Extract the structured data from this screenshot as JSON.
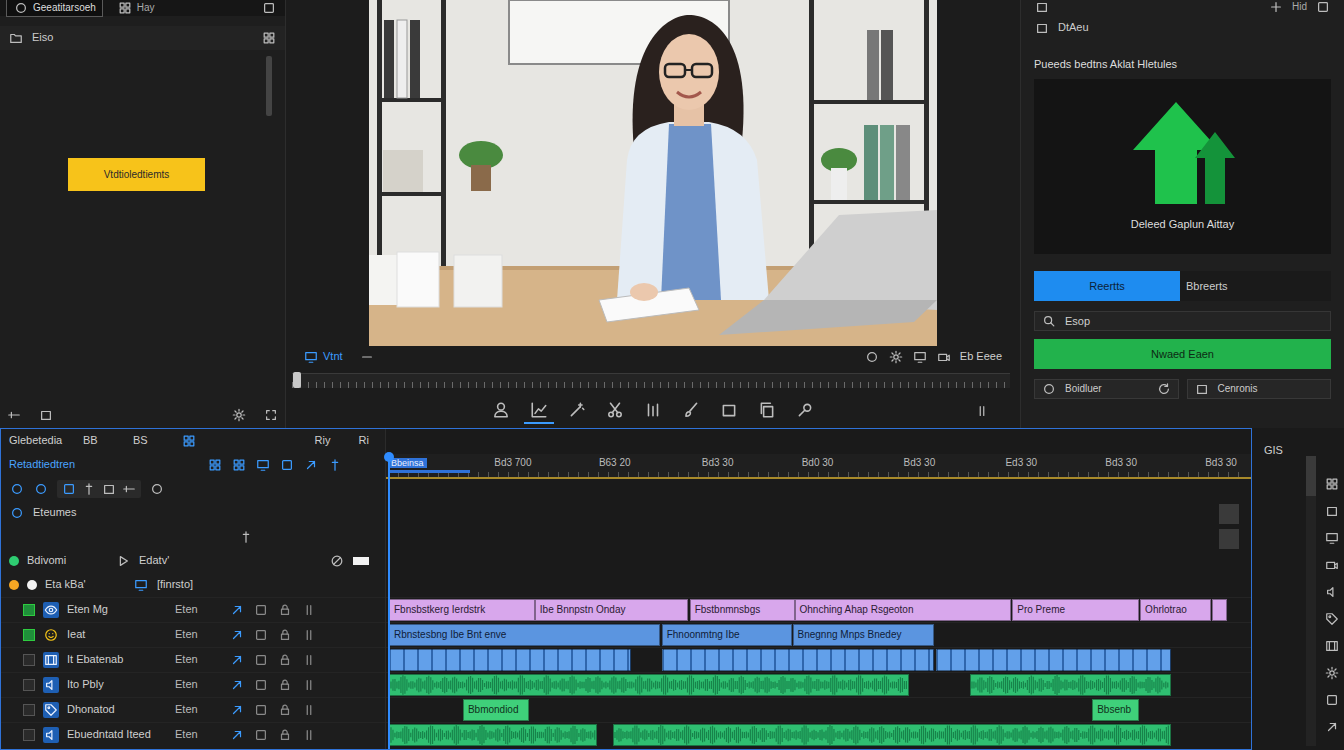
{
  "source_panel": {
    "tabs": [
      {
        "label": "Geeatitarsoeh",
        "selected": true
      },
      {
        "label": "Hay",
        "selected": false
      }
    ],
    "title": "Eiso",
    "button": "Vtdtioledtiemts"
  },
  "viewer": {
    "label_left": "Vtnt",
    "label_right": "Eb Eeee",
    "scrubber": {
      "level": 0
    }
  },
  "toolbar": [
    {
      "selected": false
    },
    {
      "selected": true
    },
    {
      "selected": false
    },
    {
      "selected": false
    },
    {
      "selected": false
    },
    {
      "selected": false
    },
    {
      "selected": false
    },
    {
      "selected": false
    },
    {
      "selected": false
    }
  ],
  "inspector": {
    "top_label": "Hid",
    "title": "DtAeu",
    "heading": "Pueeds bedtns Aklat Hletules",
    "preview_caption": "Deleed Gaplun Aittay",
    "tabs": [
      {
        "label": "Reertts",
        "selected": true
      },
      {
        "label": "Bbreerts",
        "selected": false
      }
    ],
    "field": {
      "value": "Esop"
    },
    "primary_button": "Nwaed Eaen",
    "buttons": [
      "Boidluer",
      "Cenronis"
    ]
  },
  "timeline": {
    "header": {
      "title": "Glebetedia",
      "items": [
        "BB",
        "BS",
        "Riy",
        "Ri"
      ],
      "sequence": "Retadtiedtren",
      "section": "Eteumes",
      "groups": [
        {
          "label": "Bdivomi",
          "value": "Edatv'",
          "color": "#2ecc71"
        },
        {
          "label": "Eta kBa'",
          "value": "[finrsto]",
          "color": "#f5a623"
        }
      ]
    },
    "in_marker": "Bbeinsa",
    "ruler": [
      {
        "text": "Bd3 700",
        "time": 12.5
      },
      {
        "text": "B63 20",
        "time": 22.7
      },
      {
        "text": "Bd3 30",
        "time": 33.0
      },
      {
        "text": "Bd0 30",
        "time": 43.0
      },
      {
        "text": "Bd3 30",
        "time": 53.2
      },
      {
        "text": "Ed3 30",
        "time": 63.4
      },
      {
        "text": "Bd3 30",
        "time": 73.4
      },
      {
        "text": "Bd3 30",
        "time": 83.4
      }
    ],
    "playhead": 0,
    "tracks": [
      {
        "name": "Eten Mg",
        "label": "Eten",
        "kind": "title",
        "enabled": true,
        "clips": [
          {
            "label": "Fbnsbstkerg Ierdstrk",
            "span": [
              0.1,
              14.7
            ]
          },
          {
            "label": "Ibe Bnnpstn Onday",
            "span": [
              14.7,
              30.0
            ]
          },
          {
            "label": "Fbstbnmnsbgs",
            "span": [
              30.2,
              40.7
            ]
          },
          {
            "label": "Ohnching Ahap Rsgeoton",
            "span": [
              40.7,
              62.4
            ]
          },
          {
            "label": "Pro Preme",
            "span": [
              62.5,
              75.2
            ]
          },
          {
            "label": "Ohrlotrao",
            "span": [
              75.3,
              82.4
            ]
          },
          {
            "span": [
              82.5,
              84.0
            ]
          }
        ]
      },
      {
        "name": "Ieat",
        "label": "Eten",
        "kind": "video",
        "enabled": true,
        "clips": [
          {
            "label": "Rbnstesbng Ibe Bnt enve",
            "span": [
              0.1,
              27.2
            ]
          },
          {
            "label": "Fhnoonmtng Ibe",
            "span": [
              27.4,
              40.4
            ]
          },
          {
            "label": "Bnegnng Mnps Bnedey",
            "span": [
              40.5,
              54.7
            ]
          }
        ]
      },
      {
        "name": "It Ebatenab",
        "label": "Eten",
        "kind": "thumbs",
        "enabled": false,
        "clips": [
          {
            "span": [
              0.1,
              24.3
            ]
          },
          {
            "span": [
              27.4,
              54.7
            ]
          },
          {
            "span": [
              54.9,
              78.4
            ]
          }
        ]
      },
      {
        "name": "Ito Pbly",
        "label": "Eten",
        "kind": "audio",
        "enabled": false,
        "clips": [
          {
            "span": [
              0.1,
              52.2
            ]
          },
          {
            "span": [
              58.3,
              78.4
            ]
          }
        ]
      },
      {
        "name": "Dhonatod",
        "label": "Eten",
        "kind": "label",
        "enabled": false,
        "clips": [
          {
            "label": "Bbmondiod",
            "span": [
              7.5,
              14.1
            ]
          },
          {
            "label": "Bbsenb",
            "span": [
              70.5,
              75.2
            ]
          }
        ]
      },
      {
        "name": "Ebuedntatd Iteed",
        "label": "Eten",
        "kind": "audio",
        "enabled": false,
        "clips": [
          {
            "span": [
              0.1,
              20.9
            ]
          },
          {
            "span": [
              22.5,
              78.4
            ]
          }
        ]
      }
    ]
  },
  "side_panel": {
    "label": "GIS"
  }
}
